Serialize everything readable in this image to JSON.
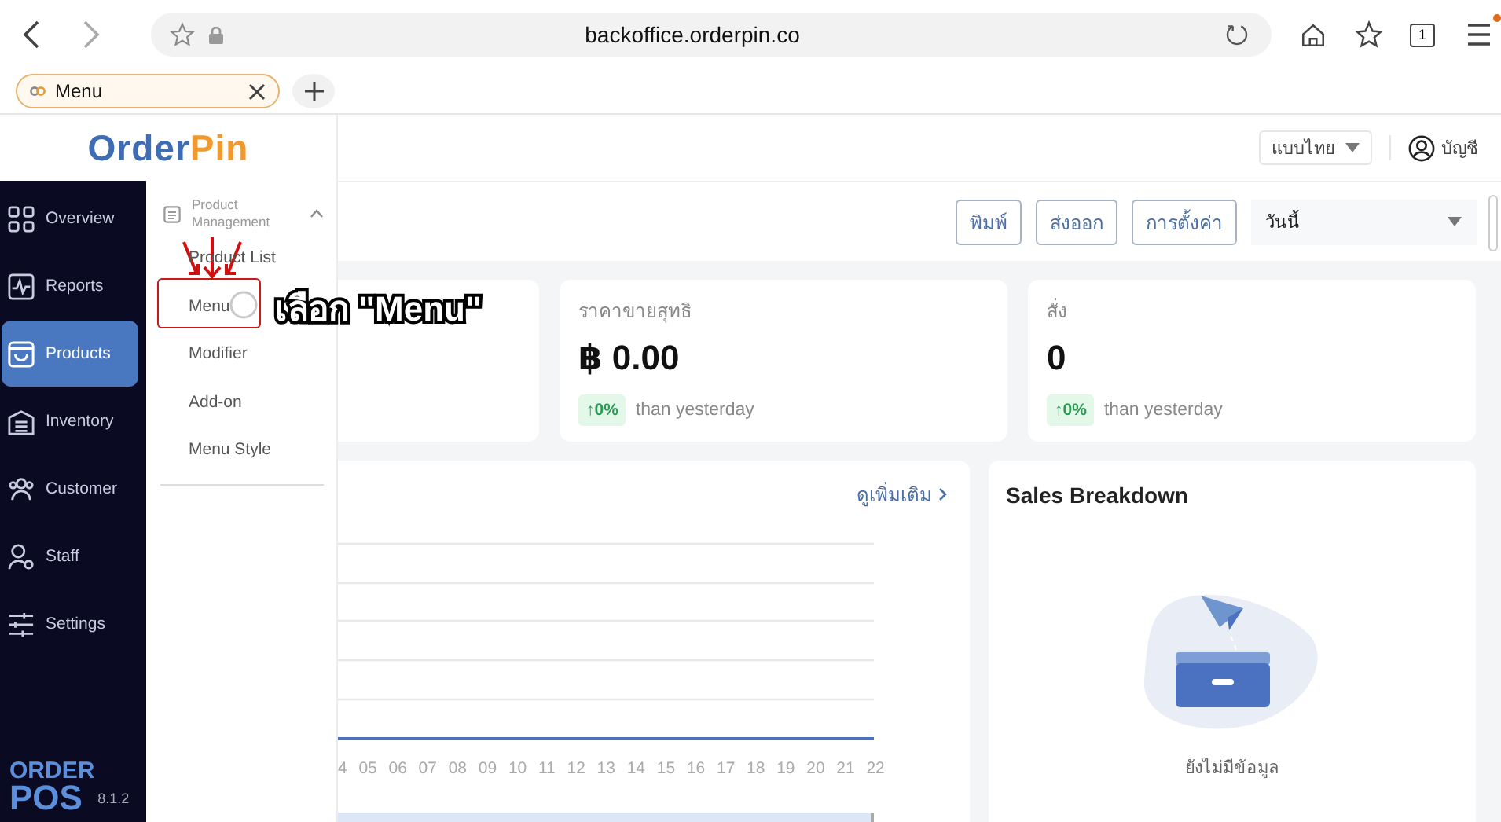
{
  "browser": {
    "url": "backoffice.orderpin.co",
    "tab_count": "1",
    "menu_notification": true
  },
  "search_tab": {
    "label": "Menu"
  },
  "logo": {
    "part1": "Order",
    "part2": "Pin"
  },
  "header": {
    "language": "แบบไทย",
    "account": "บัญชี"
  },
  "sidebar": {
    "items": [
      {
        "label": "Overview",
        "selected": false
      },
      {
        "label": "Reports",
        "selected": false
      },
      {
        "label": "Products",
        "selected": true
      },
      {
        "label": "Inventory",
        "selected": false
      },
      {
        "label": "Customer",
        "selected": false
      },
      {
        "label": "Staff",
        "selected": false
      },
      {
        "label": "Settings",
        "selected": false
      }
    ],
    "brand_top": "ORDER",
    "brand_bottom": "POS",
    "version": "8.1.2"
  },
  "submenu": {
    "title": "Product Management",
    "expanded": true,
    "items": [
      "Product List",
      "Menu",
      "Modifier",
      "Add-on",
      "Menu Style"
    ]
  },
  "toolbar": {
    "buttons": [
      "พิมพ์",
      "ส่งออก",
      "การตั้งค่า"
    ],
    "period": "วันนี้"
  },
  "stat_cards": [
    {
      "label": "ราคาขายสุทธิ",
      "value": "฿ 0.00",
      "change": "↑0%",
      "note": "than yesterday"
    },
    {
      "label": "สั่ง",
      "value": "0",
      "change": "↑0%",
      "note": "than yesterday"
    }
  ],
  "sales_chart": {
    "link": "ดูเพิ่มเติม",
    "range_slider": {
      "level": 1
    },
    "x_labels": [
      "4",
      "05",
      "06",
      "07",
      "08",
      "09",
      "10",
      "11",
      "12",
      "13",
      "14",
      "15",
      "16",
      "17",
      "18",
      "19",
      "20",
      "21",
      "22"
    ]
  },
  "sales_breakdown": {
    "title": "Sales Breakdown",
    "empty_text": "ยังไม่มีข้อมูล"
  },
  "annotation": {
    "text": "เลือก \"Menu\""
  }
}
